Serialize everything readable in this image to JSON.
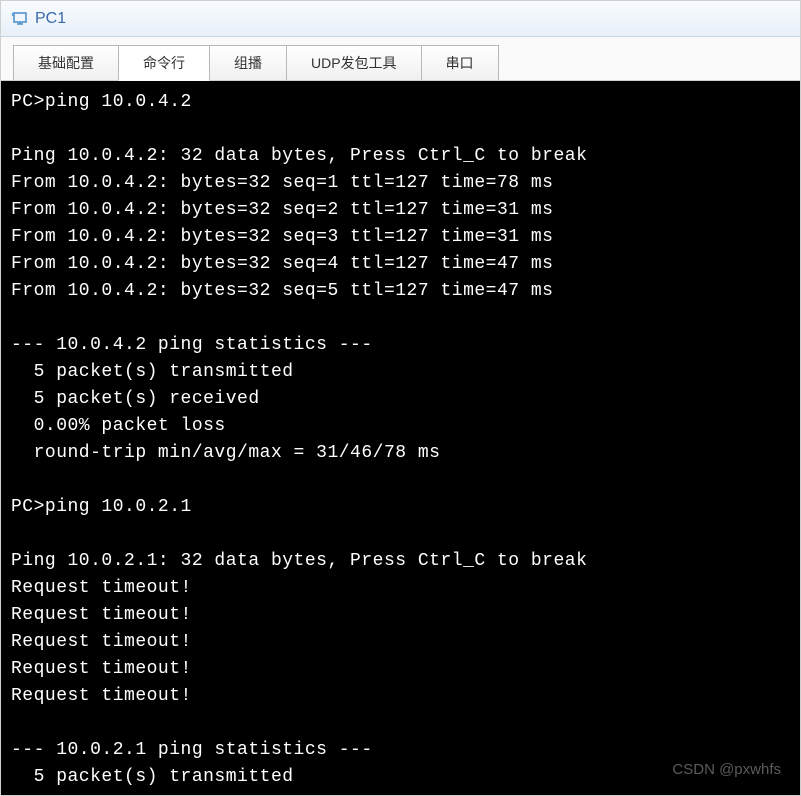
{
  "titlebar": {
    "title": "PC1"
  },
  "tabs": [
    {
      "label": "基础配置",
      "active": false
    },
    {
      "label": "命令行",
      "active": true
    },
    {
      "label": "组播",
      "active": false
    },
    {
      "label": "UDP发包工具",
      "active": false
    },
    {
      "label": "串口",
      "active": false
    }
  ],
  "terminal": {
    "lines": [
      "PC>ping 10.0.4.2",
      "",
      "Ping 10.0.4.2: 32 data bytes, Press Ctrl_C to break",
      "From 10.0.4.2: bytes=32 seq=1 ttl=127 time=78 ms",
      "From 10.0.4.2: bytes=32 seq=2 ttl=127 time=31 ms",
      "From 10.0.4.2: bytes=32 seq=3 ttl=127 time=31 ms",
      "From 10.0.4.2: bytes=32 seq=4 ttl=127 time=47 ms",
      "From 10.0.4.2: bytes=32 seq=5 ttl=127 time=47 ms",
      "",
      "--- 10.0.4.2 ping statistics ---",
      "  5 packet(s) transmitted",
      "  5 packet(s) received",
      "  0.00% packet loss",
      "  round-trip min/avg/max = 31/46/78 ms",
      "",
      "PC>ping 10.0.2.1",
      "",
      "Ping 10.0.2.1: 32 data bytes, Press Ctrl_C to break",
      "Request timeout!",
      "Request timeout!",
      "Request timeout!",
      "Request timeout!",
      "Request timeout!",
      "",
      "--- 10.0.2.1 ping statistics ---",
      "  5 packet(s) transmitted"
    ]
  },
  "watermark": "CSDN @pxwhfs"
}
